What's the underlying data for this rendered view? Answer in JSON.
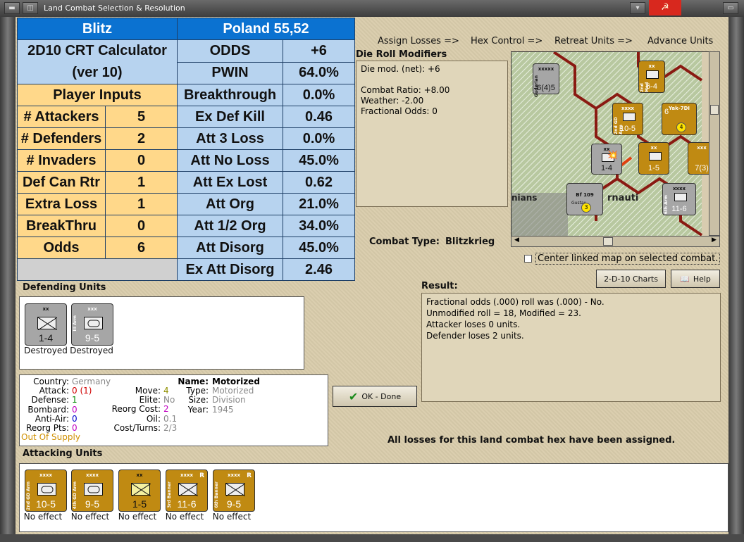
{
  "window": {
    "title": "Land Combat Selection & Resolution"
  },
  "crt": {
    "title_left": "Blitz",
    "title_right": "Poland 55,52",
    "calc_title_1": "2D10 CRT Calculator",
    "calc_title_2": "(ver 10)",
    "player_inputs": "Player Inputs",
    "inputs": [
      {
        "label": "# Attackers",
        "value": "5"
      },
      {
        "label": "# Defenders",
        "value": "2"
      },
      {
        "label": "# Invaders",
        "value": "0"
      },
      {
        "label": "Def Can Rtr",
        "value": "1"
      },
      {
        "label": "Extra Loss",
        "value": "1"
      },
      {
        "label": "BreakThru",
        "value": "0"
      },
      {
        "label": "Odds",
        "value": "6"
      }
    ],
    "outputs": [
      {
        "label": "ODDS",
        "value": "+6"
      },
      {
        "label": "PWIN",
        "value": "64.0%"
      },
      {
        "label": "Breakthrough",
        "value": "0.0%"
      },
      {
        "label": "Ex Def Kill",
        "value": "0.46"
      },
      {
        "label": "Att 3 Loss",
        "value": "0.0%"
      },
      {
        "label": "Att No Loss",
        "value": "45.0%"
      },
      {
        "label": "Att Ex Lost",
        "value": "0.62"
      },
      {
        "label": "Att Org",
        "value": "21.0%"
      },
      {
        "label": "Att 1/2 Org",
        "value": "34.0%"
      },
      {
        "label": "Att Disorg",
        "value": "45.0%"
      },
      {
        "label": "Ex Att Disorg",
        "value": "2.46"
      }
    ]
  },
  "steps": [
    "Assign Losses =>",
    "Hex Control =>",
    "Retreat Units =>",
    "Advance Units"
  ],
  "die_roll": {
    "title": "Die Roll Modifiers",
    "lines": [
      "Die mod. (net): +6",
      "",
      "Combat Ratio: +8.00",
      "Weather: -2.00",
      "Fractional Odds: 0"
    ]
  },
  "combat_type": {
    "label": "Combat Type:",
    "value": "Blitzkrieg"
  },
  "center_checkbox": "Center linked map on selected combat.",
  "buttons": {
    "charts": "2-D-10 Charts",
    "help": "Help",
    "ok": "OK - Done"
  },
  "result": {
    "title": "Result:",
    "lines": [
      "Fractional odds (.000) roll was (.000)  -  No.",
      "Unmodified roll = 18, Modified = 23.",
      "Attacker loses 0 units.",
      "Defender loses 2 units."
    ]
  },
  "status_message": "All losses for this land combat hex have been assigned.",
  "defending": {
    "title": "Defending Units",
    "units": [
      {
        "type": "xx",
        "value": "1-4",
        "status": "Destroyed",
        "name": ""
      },
      {
        "type": "xxx",
        "value": "9-5",
        "status": "Destroyed",
        "name": "III Arm"
      }
    ]
  },
  "unit_info": {
    "country_label": "Country:",
    "country": "Germany",
    "attack_label": "Attack:",
    "attack": "0",
    "attack_mod": "(1)",
    "defense_label": "Defense:",
    "defense": "1",
    "bombard_label": "Bombard:",
    "bombard": "0",
    "antiair_label": "Anti-Air:",
    "antiair": "0",
    "reorgpts_label": "Reorg Pts:",
    "reorgpts": "0",
    "supply": "Out Of Supply",
    "move_label": "Move:",
    "move": "4",
    "elite_label": "Elite:",
    "elite": "No",
    "reorgcost_label": "Reorg Cost:",
    "reorgcost": "2",
    "oil_label": "Oil:",
    "oil": "0.1",
    "costturns_label": "Cost/Turns:",
    "costturns": "2/3",
    "name_label": "Name:",
    "name": "Motorized",
    "type_label": "Type:",
    "type": "Motorized",
    "size_label": "Size:",
    "size": "Division",
    "year_label": "Year:",
    "year": "1945"
  },
  "attacking": {
    "title": "Attacking Units",
    "units": [
      {
        "type": "xxxx",
        "value": "10-5",
        "status": "No effect",
        "name": "2nd GD Arm"
      },
      {
        "type": "xxxx",
        "value": "9-5",
        "status": "No effect",
        "name": "4th GD Arm"
      },
      {
        "type": "xx",
        "value": "1-5",
        "status": "No effect",
        "name": ""
      },
      {
        "type": "xxxx",
        "value": "11-6",
        "status": "No effect",
        "name": "3rd Banner"
      },
      {
        "type": "xxxx",
        "value": "9-5",
        "status": "No effect",
        "name": "6th Banner"
      }
    ]
  },
  "map": {
    "place_label": "rnauti",
    "place_label2": "nians",
    "counters": [
      {
        "type": "xxxxx",
        "value": "6(4)5",
        "name": "Guderian"
      },
      {
        "type": "xx",
        "value": "6-4",
        "name": "2nd Med"
      },
      {
        "type": "xxxx",
        "value": "10-5",
        "name": "2nd GD Arm"
      },
      {
        "type": "Yak-7DI",
        "value": "6",
        "name": ""
      },
      {
        "type": "xx",
        "value": "1-4",
        "name": ""
      },
      {
        "type": "xx",
        "value": "1-5",
        "name": ""
      },
      {
        "type": "xxxx",
        "value": "11-6",
        "name": "6th Arm"
      },
      {
        "type": "Bf 109",
        "value": "3",
        "name": "Gustav"
      },
      {
        "type": "xxx",
        "value": "7(3)",
        "name": ""
      }
    ]
  },
  "colors": {
    "crt_header": "#0b72d1",
    "crt_calc": "#b7d3ef",
    "crt_input": "#ffd88a",
    "counter_gold": "#c08a12",
    "counter_grey": "#a6a6a6",
    "attack": "#d00000",
    "defense": "#008800",
    "bombard": "#c000c0",
    "antiair": "#0000cc",
    "supply": "#d09000"
  }
}
